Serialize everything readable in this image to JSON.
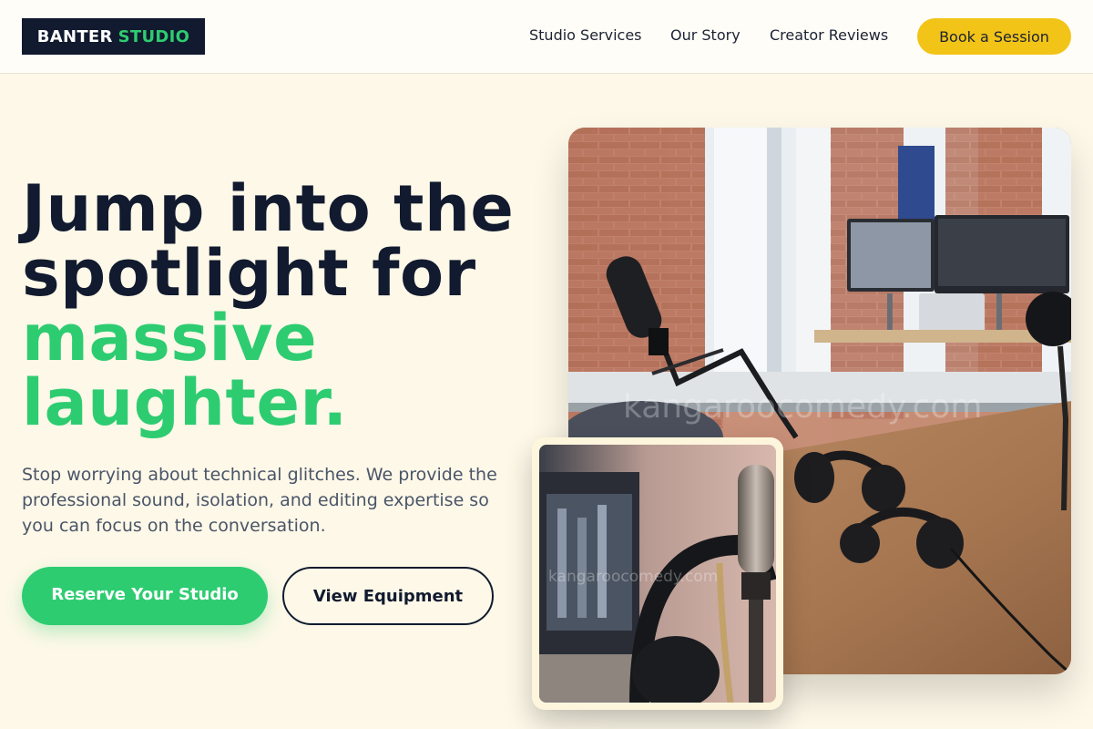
{
  "header": {
    "logo_part1": "BANTER",
    "logo_part2": "STUDIO",
    "nav": [
      {
        "label": "Studio Services"
      },
      {
        "label": "Our Story"
      },
      {
        "label": "Creator Reviews"
      }
    ],
    "cta_label": "Book a Session"
  },
  "hero": {
    "title_line1": "Jump into the",
    "title_line2": "spotlight for",
    "title_line3": "massive",
    "title_line4": "laughter.",
    "subtitle": "Stop worrying about technical glitches. We provide the professional sound, isolation, and editing expertise so you can focus on the conversation.",
    "primary_button": "Reserve Your Studio",
    "secondary_button": "View Equipment"
  },
  "images": {
    "watermark": "kangaroocomedy.com"
  },
  "colors": {
    "brand_dark": "#111a2e",
    "brand_green": "#2ecc71",
    "accent_yellow": "#f2c418",
    "background": "#fdf8e8"
  },
  "icons": [
    "podcast-studio-photo",
    "microphone-closeup-photo"
  ]
}
